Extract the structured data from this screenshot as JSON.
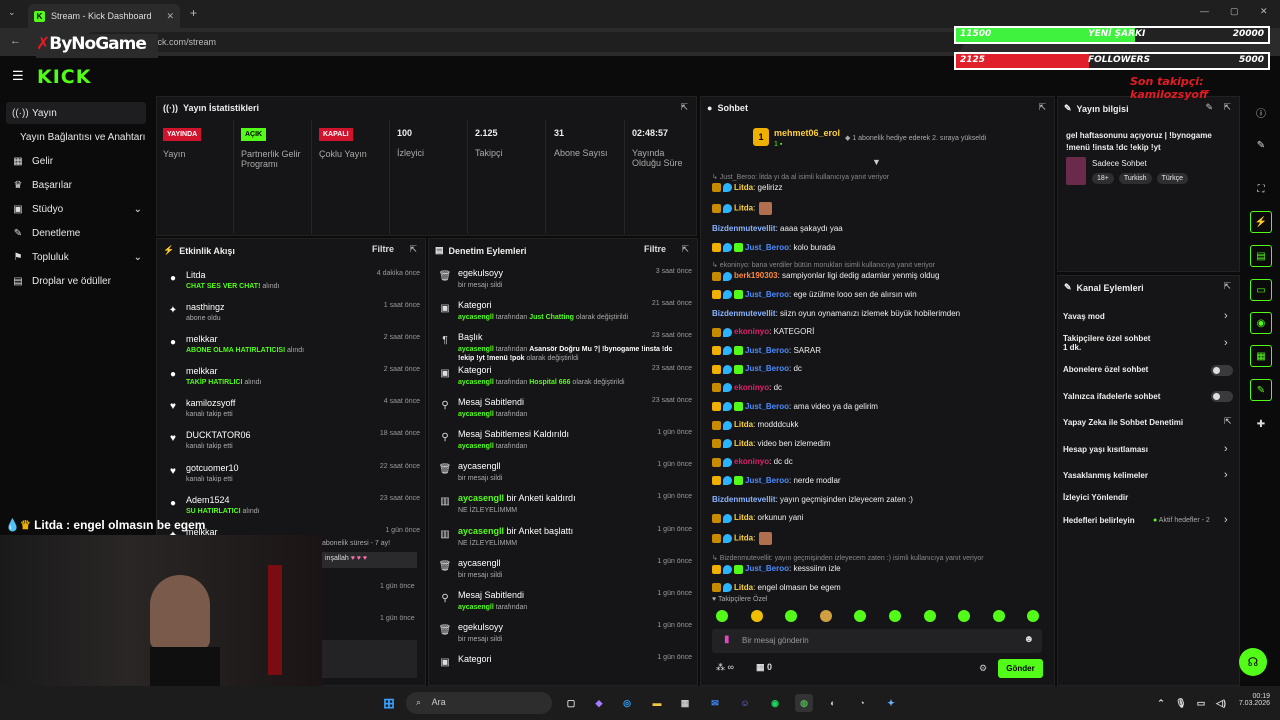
{
  "browser": {
    "tab_title": "Stream - Kick Dashboard",
    "url": "dashboard.kick.com/stream"
  },
  "overlay": {
    "logo_text": "ByNoGame",
    "song_current": "11500",
    "song_label": "YENİ ŞARKI",
    "song_target": "20000",
    "song_progress": 0.575,
    "followers_current": "2125",
    "followers_label": "FOLLOWERS",
    "followers_target": "5000",
    "followers_progress": 0.425,
    "last_follower": "Son takipçi: kamilozsyoff",
    "caption_name": "Litda",
    "caption_text": ": engel olmasın be egem"
  },
  "sidebar": {
    "items": [
      {
        "label": "Yayın",
        "icon": "broadcast-icon"
      },
      {
        "label": "Yayın Bağlantısı ve Anahtarı",
        "icon": ""
      },
      {
        "label": "Gelir",
        "icon": "dashboard-icon"
      },
      {
        "label": "Başarılar",
        "icon": "trophy-icon"
      },
      {
        "label": "Stüdyo",
        "icon": "studio-icon"
      },
      {
        "label": "Denetleme",
        "icon": "wrench-icon"
      },
      {
        "label": "Topluluk",
        "icon": "community-icon"
      },
      {
        "label": "Droplar ve ödüller",
        "icon": "drops-icon"
      }
    ]
  },
  "stats": {
    "title": "Yayın İstatistikleri",
    "items": [
      {
        "value": "YAYINDA",
        "label": "Yayın",
        "badge": "#d1142e"
      },
      {
        "value": "AÇIK",
        "label": "Partnerlik Gelir Programı",
        "badge": "#53fc18"
      },
      {
        "value": "KAPALI",
        "label": "Çoklu Yayın",
        "badge": "#d1142e"
      },
      {
        "value": "100",
        "label": "İzleyici"
      },
      {
        "value": "2.125",
        "label": "Takipçi"
      },
      {
        "value": "31",
        "label": "Abone Sayısı"
      },
      {
        "value": "02:48:57",
        "label": "Yayında Olduğu Süre"
      }
    ]
  },
  "activity": {
    "title": "Etkinlik Akışı",
    "filter": "Filtre",
    "rows": [
      {
        "name": "Litda",
        "highlight": "CHAT SES VER CHAT!",
        "rest": " alındı",
        "time": "4 dakika önce"
      },
      {
        "name": "nasthingz",
        "highlight": "",
        "rest": "abone oldu",
        "time": "1 saat önce"
      },
      {
        "name": "melkkar",
        "highlight": "ABONE OLMA HATIRLATICISI",
        "rest": " alındı",
        "time": "2 saat önce"
      },
      {
        "name": "melkkar",
        "highlight": "TAKİP HATIRLICI",
        "rest": " alındı",
        "time": "2 saat önce"
      },
      {
        "name": "kamilozsyoff",
        "highlight": "",
        "rest": "kanalı takip etti",
        "time": "4 saat önce"
      },
      {
        "name": "DUCKTATOR06",
        "highlight": "",
        "rest": "kanalı takip etti",
        "time": "18 saat önce"
      },
      {
        "name": "gotcuomer10",
        "highlight": "",
        "rest": "kanalı takip etti",
        "time": "22 saat önce"
      },
      {
        "name": "Adem1524",
        "highlight": "SU HATIRLATICI",
        "rest": " alındı",
        "time": "23 saat önce"
      },
      {
        "name": "melkkar",
        "highlight": "",
        "rest": "",
        "time": "1 gün önce"
      }
    ],
    "partial": {
      "sub": "abonelik süresi - 7 ay!",
      "msg": "inşallah",
      "times": [
        "1 gün önce",
        "1 gün önce"
      ]
    }
  },
  "moderation": {
    "title": "Denetim Eylemleri",
    "filter": "Filtre",
    "rows": [
      {
        "name": "egekulsoyy",
        "sub": "bir mesajı sildi",
        "hl": "",
        "time": "3 saat önce"
      },
      {
        "name": "Kategori",
        "sub_a": "aycasengll",
        "sub_b": " tarafından ",
        "hl": "Just Chatting",
        "sub_c": " olarak değiştirildi",
        "time": "21 saat önce"
      },
      {
        "name": "Başlık",
        "sub_a": "aycasengll",
        "sub_b": " tarafından ",
        "hl": "Asansör Doğru Mu ?| !bynogame !insta !dc !ekip !yt !menü !pok",
        "sub_c": " olarak değiştirildi",
        "time": "23 saat önce"
      },
      {
        "name": "Kategori",
        "sub_a": "aycasengll",
        "sub_b": " tarafından ",
        "hl": "Hospital 666",
        "sub_c": " olarak değiştirildi",
        "time": "23 saat önce"
      },
      {
        "name": "Mesaj Sabitlendi",
        "sub_a": "aycasengll",
        "sub_b": " tarafından",
        "hl": "",
        "sub_c": "",
        "time": "23 saat önce"
      },
      {
        "name": "Mesaj Sabitlemesi Kaldırıldı",
        "sub_a": "aycasengll",
        "sub_b": " tarafından",
        "hl": "",
        "sub_c": "",
        "time": "1 gün önce"
      },
      {
        "name": "aycasengll",
        "sub": "bir mesajı sildi",
        "hl": "",
        "time": "1 gün önce"
      },
      {
        "name_hl": "aycasengll",
        "name": " bir Anketi kaldırdı",
        "sub": "NE İZLEYELİMMM",
        "time": "1 gün önce"
      },
      {
        "name_hl": "aycasengll",
        "name": " bir Anket başlattı",
        "sub": "NE İZLEYELİMMM",
        "time": "1 gün önce"
      },
      {
        "name": "aycasengll",
        "sub": "bir mesajı sildi",
        "hl": "",
        "time": "1 gün önce"
      },
      {
        "name": "Mesaj Sabitlendi",
        "sub_a": "aycasengll",
        "sub_b": " tarafından",
        "hl": "",
        "sub_c": "",
        "time": "1 gün önce"
      },
      {
        "name": "egekulsoyy",
        "sub": "bir mesajı sildi",
        "hl": "",
        "time": "1 gün önce"
      },
      {
        "name": "Kategori",
        "sub": "",
        "hl": "",
        "time": "1 gün önce"
      }
    ]
  },
  "chat": {
    "title": "Sohbet",
    "pinned_user": "mehmet06_erol",
    "pinned_level": "1",
    "pinned_text": "1 abonelik hediye ederek 2. sıraya yükseldi",
    "messages": [
      {
        "type": "meta",
        "text": "↳ Just_Beroo: litda yı da al isimli kullanıcıya yanıt veriyor"
      },
      {
        "user": "Litda",
        "color": "#ffd23c",
        "text": ": gelirizz"
      },
      {
        "user": "Litda",
        "color": "#ffd23c",
        "text": ":"
      },
      {
        "user": "Bizdenmutevellit",
        "color": "#8ab4ff",
        "text": ": aaaa şakaydı yaa"
      },
      {
        "user": "Just_Beroo",
        "color": "#4b8bff",
        "text": ": kolo burada"
      },
      {
        "type": "meta",
        "text": "↳ ekoninyo: bana verdiler bütün moruklan isimli kullanıcıya yanıt veriyor"
      },
      {
        "user": "berk190303",
        "color": "#ff8a3d",
        "text": ": sampiyonlar ligi dedig adamlar yenmiş oldug"
      },
      {
        "user": "Just_Beroo",
        "color": "#4b8bff",
        "text": ": ege üzülme looo sen de alırsın win"
      },
      {
        "user": "Bizdenmutevellit",
        "color": "#8ab4ff",
        "text": ": siizn oyun oynamanızı izlemek büyük hobilerimden"
      },
      {
        "user": "ekoninyo",
        "color": "#e0206c",
        "text": ": KATEGORİ"
      },
      {
        "user": "Just_Beroo",
        "color": "#4b8bff",
        "text": ": SARAR"
      },
      {
        "user": "Just_Beroo",
        "color": "#4b8bff",
        "text": ": dc"
      },
      {
        "user": "ekoninyo",
        "color": "#e0206c",
        "text": ": dc"
      },
      {
        "user": "Just_Beroo",
        "color": "#4b8bff",
        "text": ": ama video ya da gelirim"
      },
      {
        "user": "Litda",
        "color": "#ffd23c",
        "text": ": modddcukk"
      },
      {
        "user": "Litda",
        "color": "#ffd23c",
        "text": ": video ben izlemedim"
      },
      {
        "user": "ekoninyo",
        "color": "#e0206c",
        "text": ": dc dc"
      },
      {
        "user": "Just_Beroo",
        "color": "#4b8bff",
        "text": ": nerde modlar"
      },
      {
        "user": "Bizdenmutevellit",
        "color": "#8ab4ff",
        "text": ": yayın geçmişinden izleyecem zaten :)"
      },
      {
        "user": "Litda",
        "color": "#ffd23c",
        "text": ": orkunun yani"
      },
      {
        "user": "Litda",
        "color": "#ffd23c",
        "text": ":"
      },
      {
        "type": "meta",
        "text": "↳ Bizdenmutevellit: yayın geçmişinden izleyecem zaten :) isimli kullanıcıya yanıt veriyor"
      },
      {
        "user": "Just_Beroo",
        "color": "#4b8bff",
        "text": ": kesssiinn izle"
      },
      {
        "user": "Litda",
        "color": "#ffd23c",
        "text": ": engel olmasın be egem"
      }
    ],
    "followers_only": "Takipçilere Özel",
    "input_placeholder": "Bir mesaj gönderin",
    "points": "∞",
    "gift_count": "0",
    "send_label": "Gönder"
  },
  "stream_info": {
    "title": "Yayın bilgisi",
    "stream_title": "gel haftasonunu açıyoruz | !bynogame !menü !insta !dc !ekip !yt",
    "category": "Sadece Sohbet",
    "tags": [
      "18+",
      "Turkish",
      "Türkçe"
    ]
  },
  "channel_actions": {
    "title": "Kanal Eylemleri",
    "items": [
      {
        "label": "Yavaş mod",
        "control": "chevron"
      },
      {
        "label": "Takipçilere özel sohbet",
        "sub": "1 dk.",
        "control": "chevron"
      },
      {
        "label": "Abonelere özel sohbet",
        "control": "toggle"
      },
      {
        "label": "Yalnızca ifadelerle sohbet",
        "control": "toggle"
      },
      {
        "label": "Yapay Zeka ile Sohbet Denetimi",
        "control": "external"
      },
      {
        "label": "Hesap yaşı kısıtlaması",
        "control": "chevron"
      },
      {
        "label": "Yasaklanmış kelimeler",
        "control": "chevron"
      },
      {
        "label": "İzleyici Yönlendir",
        "control": "none"
      },
      {
        "label": "Hedefleri belirleyin",
        "status": "Aktif hedefler - 2",
        "control": "chevron"
      }
    ]
  },
  "taskbar": {
    "search": "Ara",
    "time": "00:19",
    "date": "7.03.2026"
  },
  "colors": {
    "accent": "#53fc18",
    "live": "#d1142e",
    "panel": "#151517",
    "background": "#0b0b0c"
  }
}
